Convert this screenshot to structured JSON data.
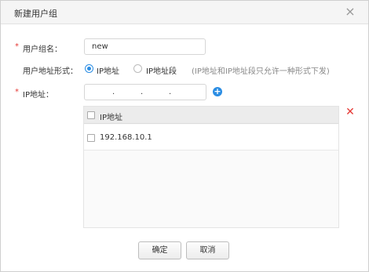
{
  "dialog": {
    "title": "新建用户组",
    "close_glyph": "×"
  },
  "form": {
    "required_mark": "*",
    "group_name_label": "用户组名：",
    "group_name_value": "new",
    "address_type_label": "用户地址形式：",
    "address_options": [
      {
        "label": "IP地址",
        "selected": true
      },
      {
        "label": "IP地址段",
        "selected": false
      }
    ],
    "address_hint": "(IP地址和IP地址段只允许一种形式下发)",
    "ip_label": "IP地址：",
    "ip_separator": ".",
    "add_glyph": "+"
  },
  "table": {
    "header": "IP地址",
    "rows": [
      "192.168.10.1"
    ],
    "delete_glyph": "✕"
  },
  "footer": {
    "confirm_label": "确定",
    "cancel_label": "取消"
  },
  "colors": {
    "accent": "#2b8de3",
    "required": "#e53935",
    "delete": "#e53935"
  }
}
